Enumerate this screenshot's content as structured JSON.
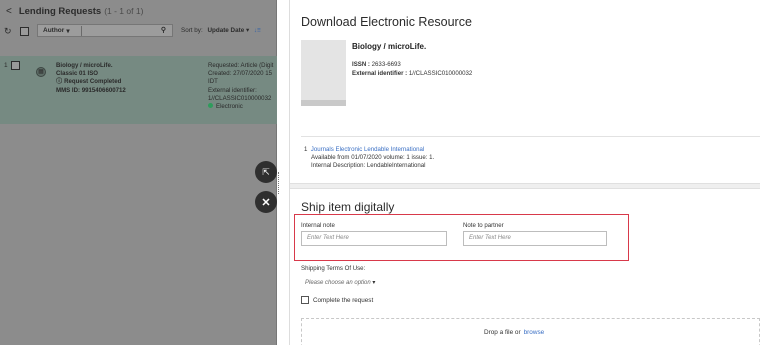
{
  "left_panel": {
    "back_icon": "chevron-left-icon",
    "title": "Lending Requests",
    "count": "(1 - 1 of 1)",
    "toolbar": {
      "refresh_icon": "refresh-icon",
      "author_label": "Author",
      "author_caret": "▾",
      "search_icon": "search-icon",
      "sort_label": "Sort by:",
      "sort_value": "Update Date",
      "sort_caret": "▾",
      "sort_dir_icon": "↓≡"
    },
    "row": {
      "index": "1",
      "doc_icon": "document-icon",
      "title": "Biology / microLife.",
      "library": "Classic 01 ISO",
      "status_icon": "info-icon",
      "status": "Request Completed",
      "mms": "MMS ID: 9915406600712",
      "details": [
        "Requested: Article (Digit",
        "Created: 27/07/2020 15",
        "IDT",
        "External identifier:",
        "1//CLASSIC010000032"
      ],
      "format_dot_color": "#2e9c5c",
      "format": "Electronic"
    }
  },
  "fabs": {
    "expand_icon": "expand-icon",
    "close_icon": "close-icon"
  },
  "right_panel": {
    "title": "Download Electronic Resource",
    "resource": {
      "title": "Biology / microLife.",
      "issn_label": "ISSN :",
      "issn": "2633-6693",
      "ext_label": "External identifier :",
      "ext_id": "1//CLASSIC010000032"
    },
    "portfolio": {
      "index": "1",
      "link": "Journals Electronic Lendable International",
      "availability": "Available from 01/07/2020 volume: 1 issue: 1.",
      "internal_desc_label": "Internal Description:",
      "internal_desc": "LendableInternational"
    },
    "ship_title": "Ship item digitally",
    "internal_note": {
      "label": "Internal note",
      "placeholder": "Enter Text Here"
    },
    "partner_note": {
      "label": "Note to partner",
      "placeholder": "Enter Text Here"
    },
    "terms_label": "Shipping Terms Of Use:",
    "terms_select": "Please choose an option",
    "terms_caret": "▾",
    "complete_label": "Complete the request",
    "drop_text": "Drop a file or",
    "browse": "browse",
    "highlight_color": "#d8394a"
  }
}
